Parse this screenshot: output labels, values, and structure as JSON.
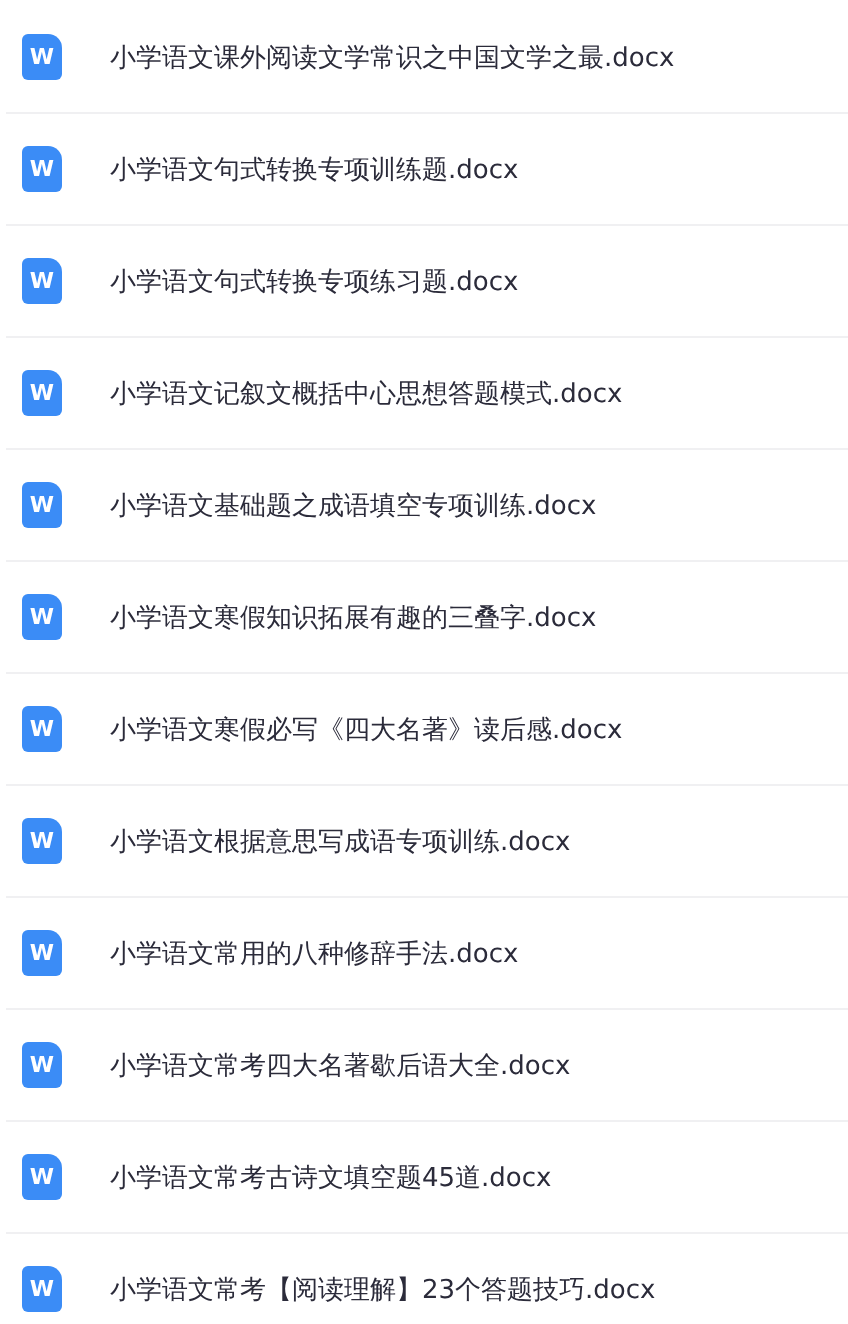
{
  "files": [
    {
      "icon_text": "W",
      "name": "小学语文课外阅读文学常识之中国文学之最.docx"
    },
    {
      "icon_text": "W",
      "name": "小学语文句式转换专项训练题.docx"
    },
    {
      "icon_text": "W",
      "name": "小学语文句式转换专项练习题.docx"
    },
    {
      "icon_text": "W",
      "name": "小学语文记叙文概括中心思想答题模式.docx"
    },
    {
      "icon_text": "W",
      "name": "小学语文基础题之成语填空专项训练.docx"
    },
    {
      "icon_text": "W",
      "name": "小学语文寒假知识拓展有趣的三叠字.docx"
    },
    {
      "icon_text": "W",
      "name": "小学语文寒假必写《四大名著》读后感.docx"
    },
    {
      "icon_text": "W",
      "name": "小学语文根据意思写成语专项训练.docx"
    },
    {
      "icon_text": "W",
      "name": "小学语文常用的八种修辞手法.docx"
    },
    {
      "icon_text": "W",
      "name": "小学语文常考四大名著歇后语大全.docx"
    },
    {
      "icon_text": "W",
      "name": "小学语文常考古诗文填空题45道.docx"
    },
    {
      "icon_text": "W",
      "name": "小学语文常考【阅读理解】23个答题技巧.docx"
    }
  ]
}
